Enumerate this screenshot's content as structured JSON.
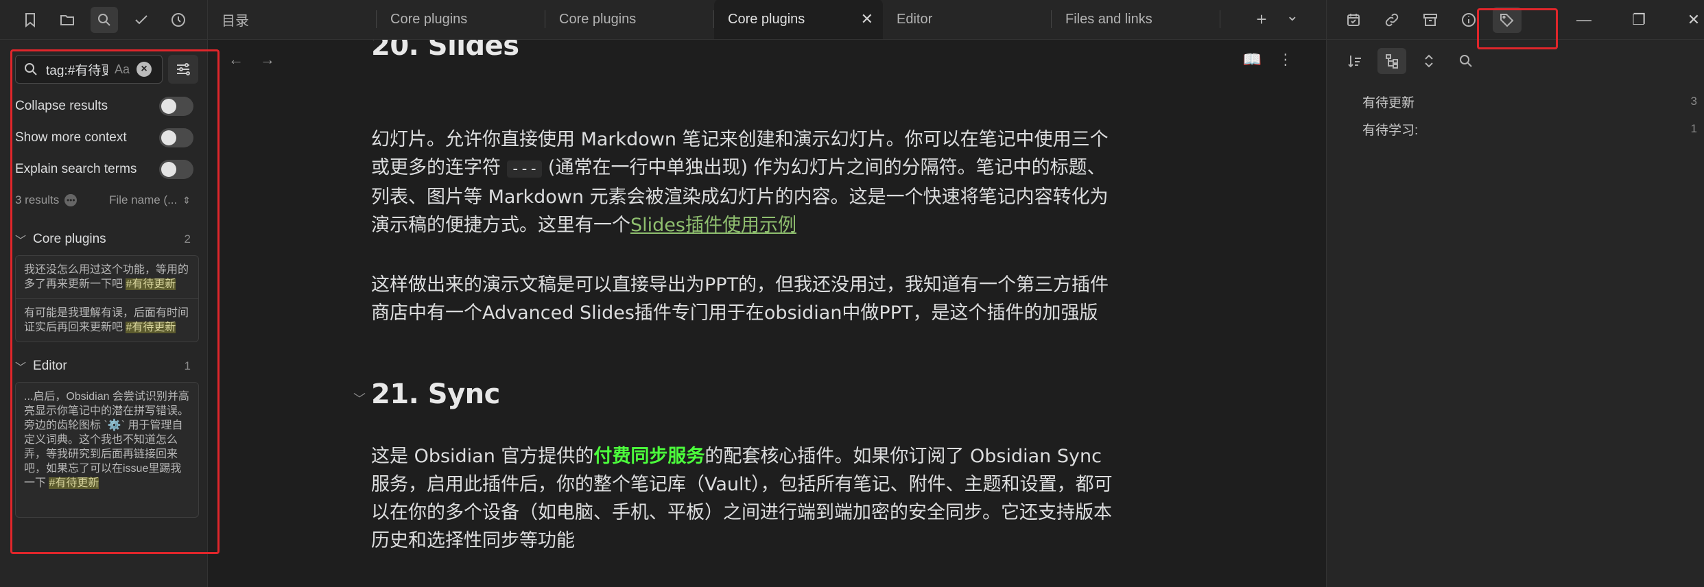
{
  "left_ribbon": {
    "icons": [
      "bookmark-icon",
      "folder-icon",
      "search-icon",
      "check-icon",
      "clock-icon"
    ]
  },
  "search": {
    "query": "tag:#有待更新",
    "match_case": "Aa",
    "options": [
      {
        "label": "Collapse results",
        "on": false
      },
      {
        "label": "Show more context",
        "on": false
      },
      {
        "label": "Explain search terms",
        "on": false
      }
    ],
    "results_count": "3 results",
    "sort": "File name (..."
  },
  "results": [
    {
      "file": "Core plugins",
      "count": "2",
      "matches": [
        {
          "text": "我还没怎么用过这个功能，等用的多了再来更新一下吧 ",
          "tag": "#有待更新"
        },
        {
          "text": "有可能是我理解有误，后面有时间证实后再回来更新吧 ",
          "tag": "#有待更新"
        }
      ]
    },
    {
      "file": "Editor",
      "count": "1",
      "matches": [
        {
          "text": "...启后，Obsidian 会尝试识别并高亮显示你笔记中的潜在拼写错误。旁边的齿轮图标 `⚙️` 用于管理自定义词典。这个我也不知道怎么弄，等我研究到后面再链接回来吧，如果忘了可以在issue里踢我一下 ",
          "tag": "#有待更新"
        }
      ]
    }
  ],
  "tabs": [
    {
      "label": "目录",
      "active": false
    },
    {
      "label": "Core plugins",
      "active": false
    },
    {
      "label": "Core plugins",
      "active": false
    },
    {
      "label": "Core plugins",
      "active": true
    },
    {
      "label": "Editor",
      "active": false
    },
    {
      "label": "Files and links",
      "active": false
    }
  ],
  "tab_actions": {
    "add": "+",
    "more": "⌄"
  },
  "editor": {
    "h20": "20. Slides",
    "p1_a": "幻灯片。允许你直接使用 Markdown 笔记来创建和演示幻灯片。你可以在笔记中使用三个或更多的连字符 ",
    "p1_code": "---",
    "p1_b": " (通常在一行中单独出现) 作为幻灯片之间的分隔符。笔记中的标题、列表、图片等 Markdown 元素会被渲染成幻灯片的内容。这是一个快速将笔记内容转化为演示稿的便捷方式。这里有一个",
    "p1_link": "Slides插件使用示例",
    "p2": "这样做出来的演示文稿是可以直接导出为PPT的，但我还没用过，我知道有一个第三方插件商店中有一个Advanced Slides插件专门用于在obsidian中做PPT，是这个插件的加强版",
    "h21": "21. Sync",
    "p3_a": "这是 Obsidian 官方提供的",
    "p3_strong": "付费同步服务",
    "p3_b": "的配套核心插件。如果你订阅了 Obsidian Sync 服务，启用此插件后，你的整个笔记库（Vault），包括所有笔记、附件、主题和设置，都可以在你的多个设备（如电脑、手机、平板）之间进行端到端加密的安全同步。它还支持版本历史和选择性同步等功能"
  },
  "right_ribbon": {
    "icons": [
      "calendar-check-icon",
      "link-icon",
      "archive-icon",
      "info-icon",
      "tags-icon"
    ]
  },
  "tags": [
    {
      "name": "有待更新",
      "count": "3"
    },
    {
      "name": "有待学习:",
      "count": "1"
    }
  ],
  "colors": {
    "accent_red": "#e0262b",
    "highlight": "#5c5b2e",
    "link": "#8fbf6f",
    "strong_green": "#4cff3c"
  }
}
